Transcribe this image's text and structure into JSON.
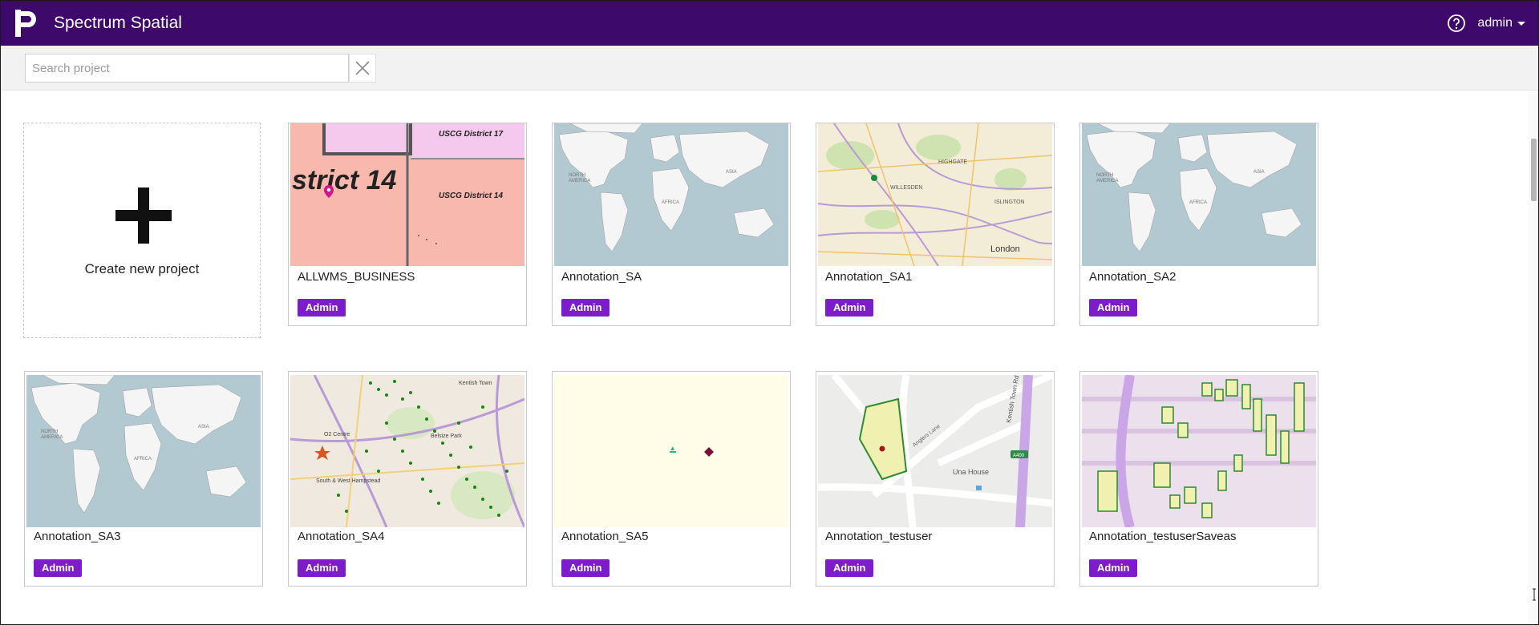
{
  "app": {
    "title": "Spectrum Spatial",
    "user": "admin",
    "brand_color": "#3d0a6b",
    "accent_color": "#7d1ccb"
  },
  "search": {
    "placeholder": "Search project",
    "value": ""
  },
  "create": {
    "label": "Create new project"
  },
  "projects": [
    {
      "name": "ALLWMS_BUSINESS",
      "role": "Admin",
      "thumb": "district-map"
    },
    {
      "name": "Annotation_SA",
      "role": "Admin",
      "thumb": "world-map"
    },
    {
      "name": "Annotation_SA1",
      "role": "Admin",
      "thumb": "london-map"
    },
    {
      "name": "Annotation_SA2",
      "role": "Admin",
      "thumb": "world-map"
    },
    {
      "name": "Annotation_SA3",
      "role": "Admin",
      "thumb": "world-map"
    },
    {
      "name": "Annotation_SA4",
      "role": "Admin",
      "thumb": "points-map"
    },
    {
      "name": "Annotation_SA5",
      "role": "Admin",
      "thumb": "blank-map"
    },
    {
      "name": "Annotation_testuser",
      "role": "Admin",
      "thumb": "street-map"
    },
    {
      "name": "Annotation_testuserSaveas",
      "role": "Admin",
      "thumb": "parcels-map"
    }
  ],
  "map_labels": {
    "district17": "USCG District 17",
    "district14": "USCG District 14",
    "district_big": "strict 14",
    "london": "London",
    "willesden": "WILLESDEN",
    "highgate": "HIGHGATE",
    "islington": "ISLINGTON",
    "belsize": "Belsize Park",
    "o2": "O2 Centre",
    "south_hampstead": "South & West Hampstead",
    "kentish_town": "Kentish Town",
    "kentish_town_rd": "Kentish Town Rd",
    "una_house": "Una House",
    "anglers_lane": "Anglers Lane",
    "a400": "A400"
  }
}
